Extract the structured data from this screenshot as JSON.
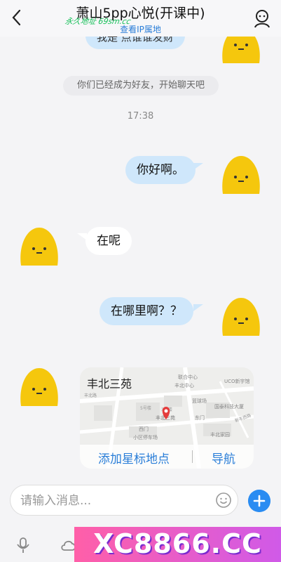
{
  "header": {
    "title": "萧山5pp心悦(开课中)",
    "subtitle": "查看IP属地",
    "watermark": "永久地址 69sm.cc"
  },
  "messages": {
    "prev_partial": "我是 点谁谁发财",
    "system_notice": "你们已经成为好友，开始聊天吧",
    "time": "17:38",
    "msg1": "你好啊。",
    "msg2": "在呢",
    "msg3": "在哪里啊？？"
  },
  "location_card": {
    "place_name": "丰北三苑",
    "map_labels": [
      "丰北中心",
      "联合中心",
      "UCO新宇馆",
      "篮球场",
      "国泰科技大厦",
      "丰北家园",
      "西门",
      "东门",
      "小区停车场",
      "丰北三苑",
      "5号楼",
      "3号楼",
      "新丰西路",
      "丰北路"
    ],
    "action_star": "添加星标地点",
    "action_nav": "导航"
  },
  "input": {
    "placeholder": "请输入消息..."
  },
  "ad": {
    "text": "XC8866.CC"
  },
  "colors": {
    "accent": "#2a7ed8",
    "my_bubble": "#cfe7fb",
    "avatar_yellow": "#f5c70d"
  }
}
